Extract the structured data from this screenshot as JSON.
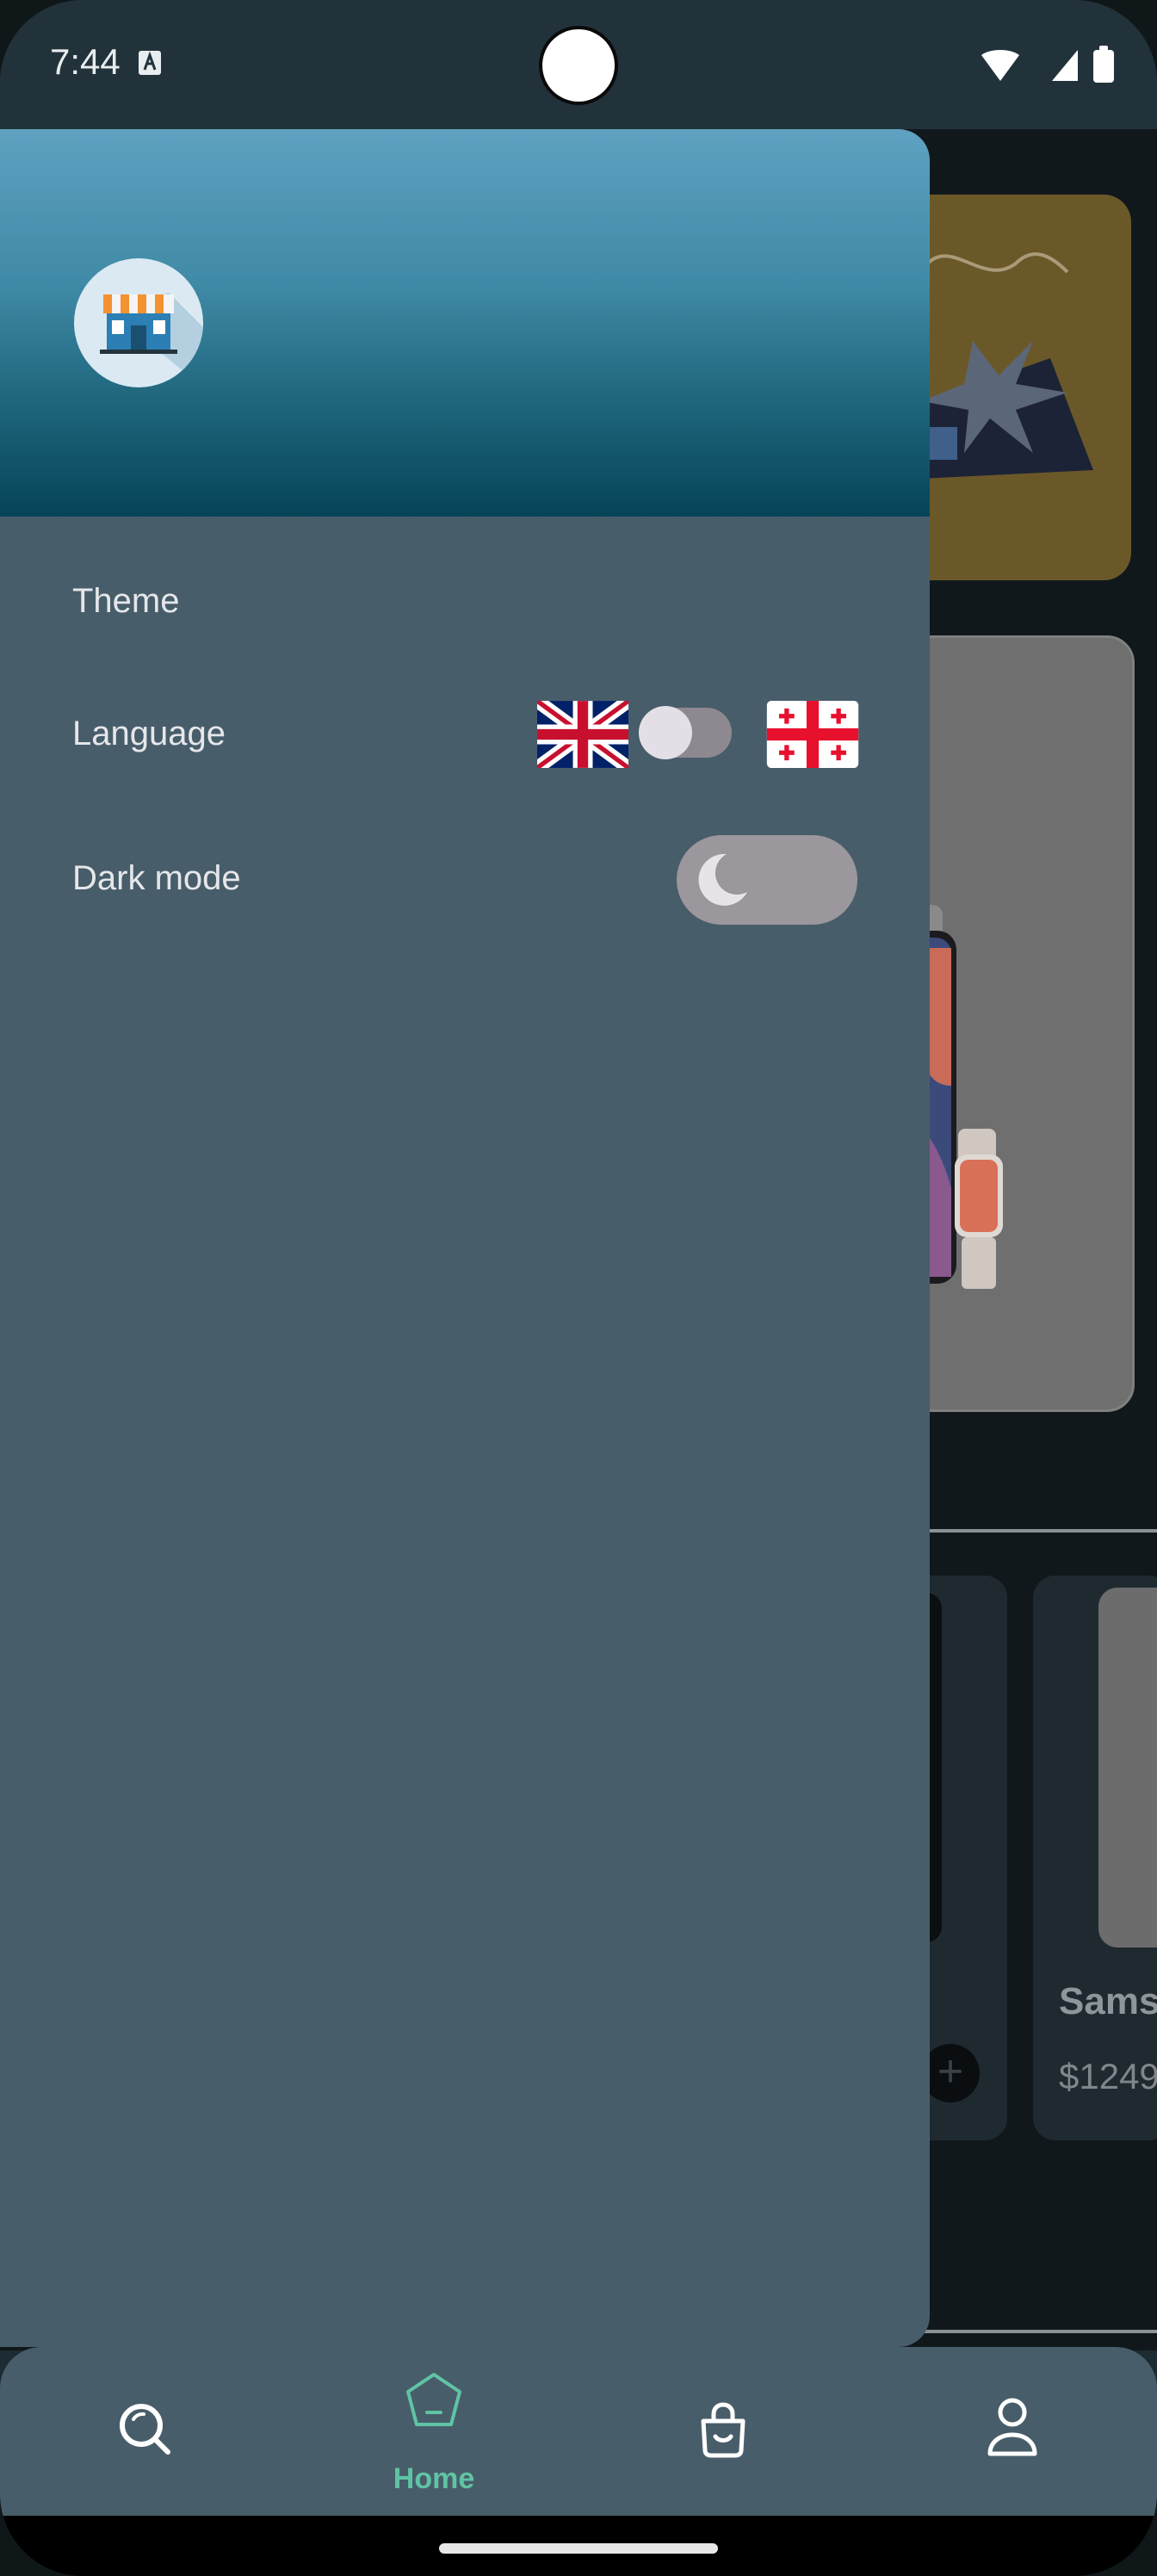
{
  "status_bar": {
    "time": "7:44"
  },
  "drawer": {
    "menu": [
      {
        "id": "theme",
        "label": "Theme"
      },
      {
        "id": "language",
        "label": "Language"
      },
      {
        "id": "dark_mode",
        "label": "Dark mode"
      }
    ],
    "language_switch": {
      "left_flag": "uk-flag-icon",
      "right_flag": "georgia-flag-icon",
      "state": "off"
    },
    "dark_mode_switch": {
      "icon": "moon-icon",
      "state": "off"
    }
  },
  "background_app": {
    "product_name": "Sams",
    "product_price": "$1249",
    "add_icon": "+"
  },
  "bottom_nav": {
    "items": [
      {
        "id": "search",
        "icon": "search-icon",
        "label": ""
      },
      {
        "id": "home",
        "icon": "home-icon",
        "label": "Home",
        "active": true
      },
      {
        "id": "bag",
        "icon": "shopping-bag-icon",
        "label": ""
      },
      {
        "id": "profile",
        "icon": "user-icon",
        "label": ""
      }
    ]
  },
  "colors": {
    "drawer_bg": "#485d6a",
    "header_gradient_top": "#5fa2c1",
    "header_gradient_bottom": "#064458",
    "accent_green": "#5fc4a4",
    "switch_track": "#9b979c"
  }
}
